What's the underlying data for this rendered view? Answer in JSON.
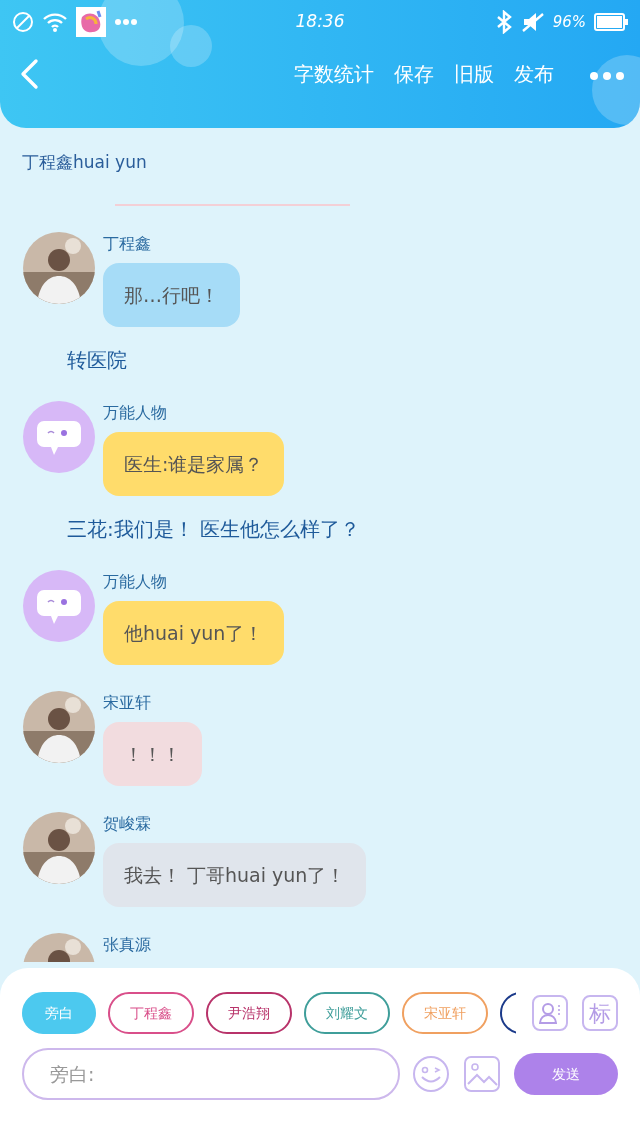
{
  "status_bar": {
    "time": "18:36",
    "battery": "96%"
  },
  "header": {
    "actions": [
      "字数统计",
      "保存",
      "旧版",
      "发布"
    ]
  },
  "document": {
    "title": "丁程鑫huai yun"
  },
  "messages": [
    {
      "kind": "message",
      "name": "丁程鑫",
      "text": "那…行吧！",
      "color": "#a6dcf7"
    },
    {
      "kind": "narration",
      "text": "转医院"
    },
    {
      "kind": "message",
      "avatar": {
        "kind": "icon"
      },
      "name": "万能人物",
      "text": "医生:谁是家属？",
      "color": "#ffdc6b"
    },
    {
      "kind": "narration",
      "text": "三花:我们是！ 医生他怎么样了？"
    },
    {
      "kind": "message",
      "avatar": {
        "kind": "icon"
      },
      "name": "万能人物",
      "text": "他huai yun了！",
      "color": "#ffdc6b"
    },
    {
      "kind": "message",
      "name": "宋亚轩",
      "text": "！！！",
      "color": "#f2dcdf"
    },
    {
      "kind": "message",
      "name": "贺峻霖",
      "text": "我去！ 丁哥huai yun了！",
      "color": "#e0e5ec"
    },
    {
      "kind": "message",
      "name": "张真源"
    }
  ],
  "composer": {
    "characters": [
      {
        "label": "旁白",
        "color": "#4cc9ef",
        "selected": true
      },
      {
        "label": "丁程鑫",
        "color": "#d94f8a",
        "selected": false
      },
      {
        "label": "尹浩翔",
        "color": "#b8336a",
        "selected": false
      },
      {
        "label": "刘耀文",
        "color": "#3f9e9a",
        "selected": false
      },
      {
        "label": "宋亚轩",
        "color": "#f0a060",
        "selected": false
      },
      {
        "color": "#1b3a8a",
        "selected": false
      }
    ],
    "tag_button": "标",
    "placeholder": "旁白:",
    "send": "发送"
  }
}
